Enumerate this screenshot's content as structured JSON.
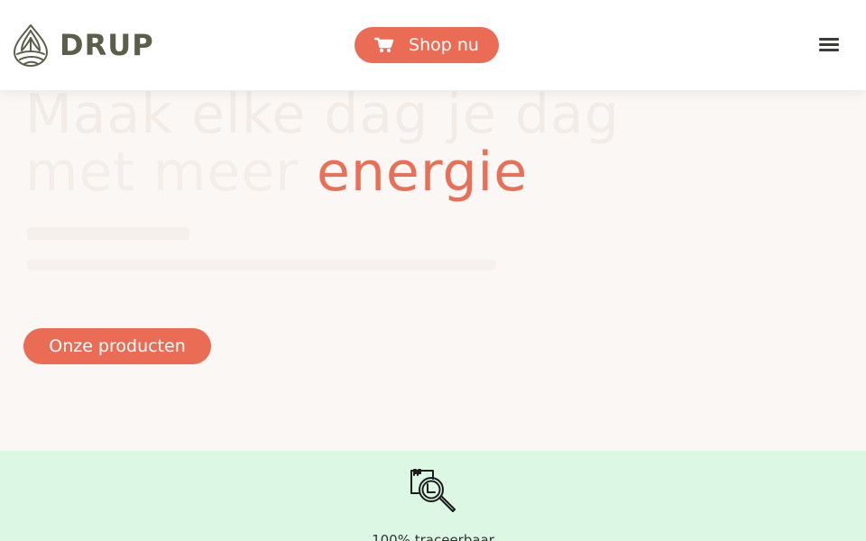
{
  "header": {
    "logo_text": "DRUP",
    "logo_icon": "leaf-drop-icon",
    "shop_button": {
      "label": "Shop nu",
      "icon": "cart-icon"
    },
    "menu_icon": "hamburger-icon"
  },
  "hero": {
    "headline_line1": "Maak elke dag je dag",
    "headline_line2_prefix": "met meer ",
    "headline_accent": "energie",
    "cta_label": "Onze producten"
  },
  "features": {
    "item1": {
      "icon": "traceability-search-icon",
      "label": "100% traceerbaar"
    }
  },
  "colors": {
    "accent": "#ea6c55",
    "logo": "#5a5e4a",
    "feature_band": "#dcf8e4",
    "hero_bg": "#faf7f5"
  }
}
